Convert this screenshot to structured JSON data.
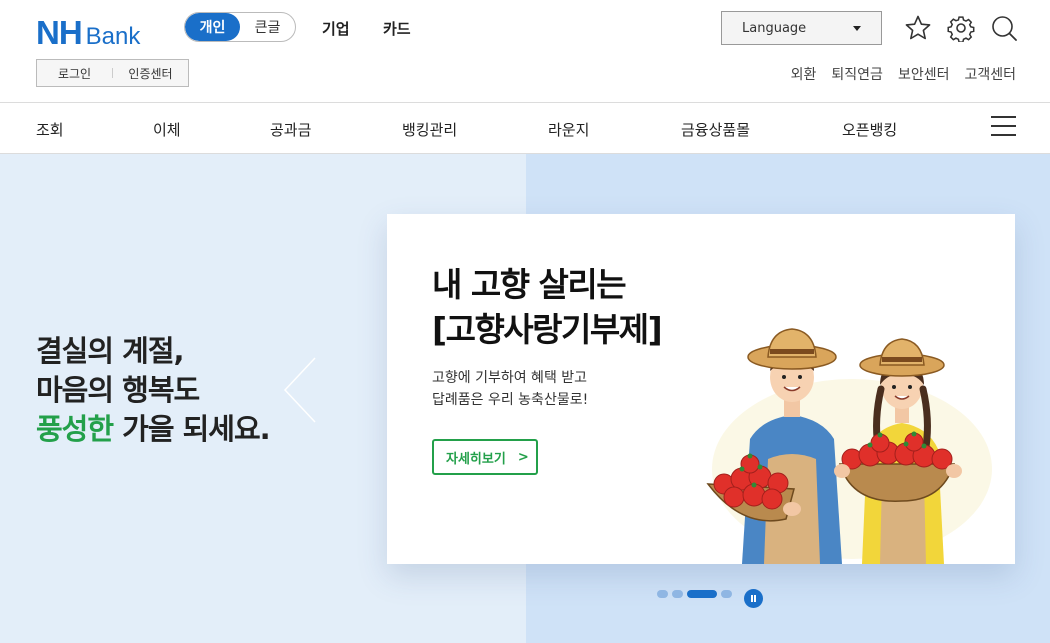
{
  "header": {
    "logo_main": "NH",
    "logo_sub": "Bank",
    "mode_toggle": [
      {
        "label": "개인",
        "active": true
      },
      {
        "label": "큰글",
        "active": false
      }
    ],
    "top_links": [
      "기업",
      "카드"
    ],
    "language_select": {
      "value": "Language"
    },
    "icons": [
      "star-icon",
      "gear-icon",
      "search-icon"
    ],
    "login_links": [
      "로그인",
      "인증센터"
    ],
    "util_links": [
      "외환",
      "퇴직연금",
      "보안센터",
      "고객센터"
    ]
  },
  "nav": {
    "items": [
      "조회",
      "이체",
      "공과금",
      "뱅킹관리",
      "라운지",
      "금융상품몰",
      "오픈뱅킹"
    ],
    "menu_icon": "hamburger-menu-icon"
  },
  "hero": {
    "line1": "결실의 계절,",
    "line2": "마음의 행복도",
    "line3_highlight": "풍성한",
    "line3_rest": " 가을 되세요.",
    "highlight_color": "#23a04a"
  },
  "banner": {
    "title_line1": "내 고향 살리는",
    "title_line2": "[고향사랑기부제]",
    "desc_line1": "고향에 기부하여 혜택 받고",
    "desc_line2": "답례품은 우리 농축산물로!",
    "button_label": "자세히보기",
    "button_chevron": ">",
    "illustration": "farmers-with-tomato-baskets-illustration"
  },
  "carousel": {
    "slide_count": 4,
    "active_index": 2
  },
  "colors": {
    "brand_blue": "#1a6fc9",
    "accent_green": "#23a04a",
    "hero_left_bg": "#e3eef9",
    "hero_right_bg": "#cfe2f7"
  }
}
